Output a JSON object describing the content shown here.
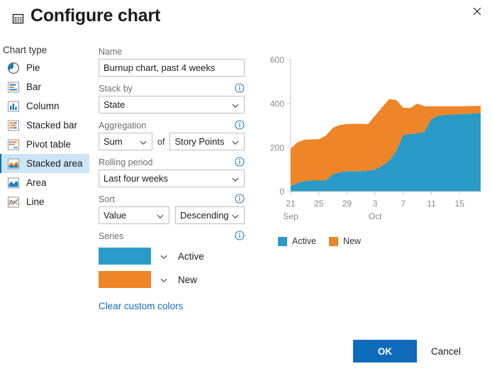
{
  "dialog": {
    "title": "Configure chart",
    "title_icon": "table-grid-icon",
    "close_icon": "close-icon"
  },
  "chart_type": {
    "label": "Chart type",
    "selected": "Stacked area",
    "items": [
      {
        "label": "Pie",
        "icon": "pie-chart-icon"
      },
      {
        "label": "Bar",
        "icon": "bar-chart-icon"
      },
      {
        "label": "Column",
        "icon": "column-chart-icon"
      },
      {
        "label": "Stacked bar",
        "icon": "stacked-bar-chart-icon"
      },
      {
        "label": "Pivot table",
        "icon": "pivot-table-icon"
      },
      {
        "label": "Stacked area",
        "icon": "stacked-area-chart-icon"
      },
      {
        "label": "Area",
        "icon": "area-chart-icon"
      },
      {
        "label": "Line",
        "icon": "line-chart-icon"
      }
    ]
  },
  "form": {
    "name": {
      "label": "Name",
      "value": "Burnup chart, past 4 weeks",
      "placeholder": ""
    },
    "stack_by": {
      "label": "Stack by",
      "value": "State",
      "info_icon": "info-icon"
    },
    "aggregation": {
      "label": "Aggregation",
      "function": "Sum",
      "of_text": "of",
      "field": "Story Points",
      "info_icon": "info-icon"
    },
    "rolling_period": {
      "label": "Rolling period",
      "value": "Last four weeks",
      "info_icon": "info-icon"
    },
    "sort": {
      "label": "Sort",
      "by": "Value",
      "direction": "Descending",
      "info_icon": "info-icon"
    },
    "series": {
      "label": "Series",
      "info_icon": "info-icon",
      "items": [
        {
          "name": "Active",
          "color": "#2a9bc8"
        },
        {
          "name": "New",
          "color": "#ee8528"
        }
      ]
    },
    "clear_colors_link": "Clear custom colors"
  },
  "footer": {
    "ok_label": "OK",
    "cancel_label": "Cancel",
    "ok_color": "#0f6cbd"
  },
  "chart_data": {
    "type": "area",
    "stacked": true,
    "title": "",
    "xlabel": "",
    "ylabel": "",
    "ylim": [
      0,
      600
    ],
    "yticks": [
      0,
      200,
      400,
      600
    ],
    "grid": false,
    "legend_position": "bottom-left",
    "x_tick_labels": [
      "21",
      "25",
      "29",
      "3",
      "7",
      "11",
      "15"
    ],
    "x_tick_values": [
      0,
      4,
      8,
      12,
      16,
      20,
      24
    ],
    "month_labels": [
      {
        "label": "Sep",
        "at": 0
      },
      {
        "label": "Oct",
        "at": 12
      }
    ],
    "x": [
      0,
      1,
      2,
      3,
      4,
      5,
      6,
      7,
      8,
      9,
      10,
      11,
      12,
      13,
      14,
      15,
      16,
      17,
      18,
      19,
      20,
      21,
      22,
      23,
      24,
      25,
      26,
      27
    ],
    "series": [
      {
        "name": "Active",
        "color": "#2a9bc8",
        "values": [
          25,
          40,
          48,
          50,
          50,
          52,
          78,
          88,
          92,
          92,
          93,
          95,
          100,
          118,
          140,
          185,
          258,
          262,
          265,
          272,
          330,
          345,
          348,
          350,
          352,
          353,
          355,
          357
        ]
      },
      {
        "name": "New",
        "color": "#ee8528",
        "values": [
          170,
          185,
          188,
          187,
          188,
          202,
          212,
          215,
          215,
          216,
          215,
          212,
          245,
          265,
          280,
          232,
          123,
          118,
          135,
          116,
          58,
          43,
          40,
          38,
          36,
          35,
          34,
          33
        ]
      }
    ],
    "totals": [
      195,
      225,
      236,
      237,
      238,
      254,
      290,
      303,
      307,
      308,
      308,
      307,
      345,
      383,
      420,
      417,
      381,
      380,
      400,
      388,
      388,
      388,
      388,
      388,
      388,
      388,
      389,
      390
    ]
  }
}
